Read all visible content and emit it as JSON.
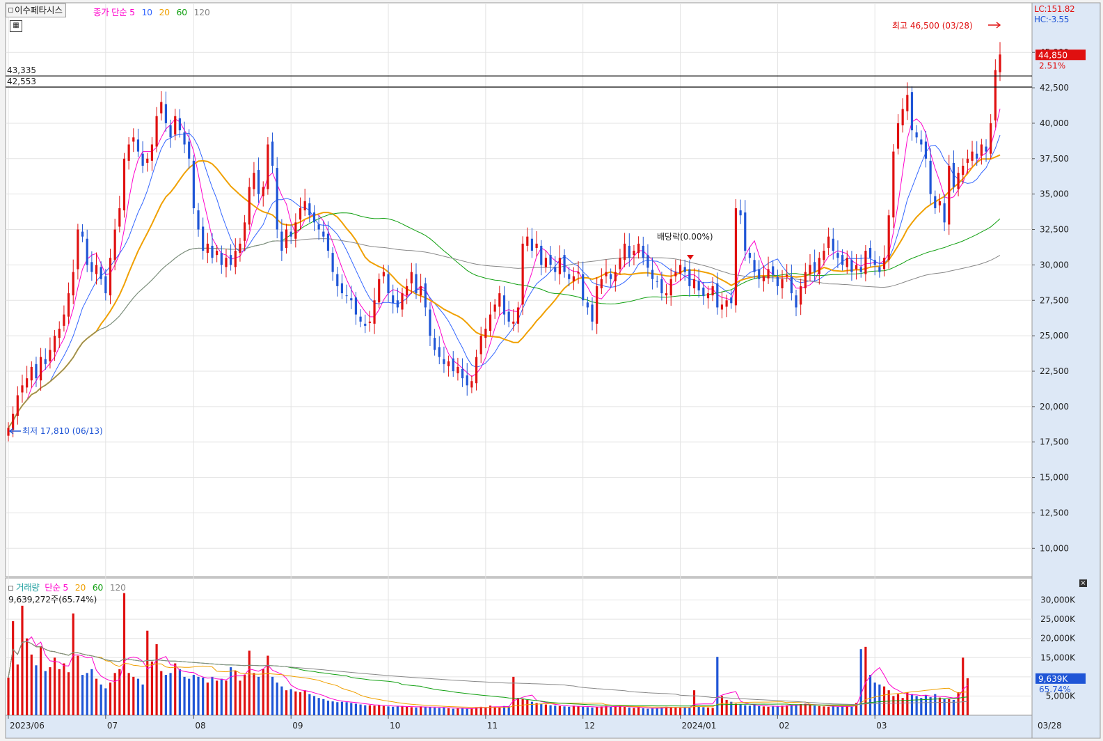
{
  "header": {
    "stock_name": "이수페타시스",
    "price_ma_title": "종가 단순",
    "price_ma_periods": [
      "5",
      "10",
      "20",
      "60",
      "120"
    ],
    "price_ma_colors": [
      "#ff00cc",
      "#3366ff",
      "#f0a000",
      "#11a011",
      "#888888"
    ],
    "volume_title": "거래량",
    "volume_ma_title": "단순",
    "volume_ma_periods": [
      "5",
      "20",
      "60",
      "120"
    ],
    "volume_ma_colors": [
      "#ff00cc",
      "#f0a000",
      "#11a011",
      "#888888"
    ],
    "volume_readout": "9,639,272주(65.74%)",
    "lc_label": "LC:151.82",
    "hc_label": "HC:-3.55"
  },
  "icons": {
    "grid": "grid-icon",
    "pane_close": "close-icon"
  },
  "colors": {
    "up": "#e01010",
    "down": "#1f55d6",
    "current_price_box": "#e01010",
    "current_volume_box": "#1f55d6"
  },
  "annotations": {
    "high_label": "최고 46,500 (03/28)",
    "low_label": "최저 17,810 (06/13)",
    "dividend_label": "배당락(0.00%)",
    "hline_upper_label": "43,335",
    "hline_lower_label": "42,553",
    "current_price": "44,850",
    "current_change": "2.51%",
    "current_volume": "9,639K",
    "current_volume_pct": "65.74%"
  },
  "chart_data": [
    {
      "type": "candlestick",
      "title": "이수페타시스",
      "y_ticks": [
        "10,000",
        "12,500",
        "15,000",
        "17,500",
        "20,000",
        "22,500",
        "25,000",
        "27,500",
        "30,000",
        "32,500",
        "35,000",
        "37,500",
        "40,000",
        "42,500",
        "45,000"
      ],
      "ylim": [
        8000,
        48500
      ],
      "hlines": [
        43335,
        42553
      ],
      "x_labels": [
        "2023/06",
        "07",
        "08",
        "09",
        "10",
        "11",
        "12",
        "2024/01",
        "02",
        "03",
        "03/28"
      ],
      "high": 46500,
      "low": 17810,
      "last_close": 44850,
      "last_change_pct": 2.51,
      "moving_averages": [
        "5",
        "10",
        "20",
        "60",
        "120"
      ],
      "close_series": [
        18500,
        19500,
        20800,
        21500,
        22000,
        22800,
        22000,
        23500,
        23000,
        24000,
        25000,
        25500,
        26500,
        28000,
        29500,
        32500,
        32000,
        30000,
        29500,
        30000,
        29000,
        28000,
        30500,
        32500,
        34000,
        37500,
        38500,
        39000,
        38000,
        37000,
        37500,
        38500,
        40500,
        41500,
        40000,
        39000,
        40500,
        39500,
        38500,
        37500,
        34000,
        32500,
        31000,
        31500,
        30500,
        31000,
        30000,
        30500,
        30000,
        31000,
        31500,
        33000,
        35500,
        36500,
        35000,
        35500,
        38500,
        37000,
        32500,
        31000,
        32500,
        32000,
        33000,
        34000,
        34500,
        33500,
        33000,
        32500,
        32000,
        31000,
        29500,
        28500,
        28000,
        27800,
        27500,
        26500,
        26000,
        25700,
        26000,
        27500,
        29000,
        29500,
        28000,
        27300,
        27000,
        28000,
        28500,
        29500,
        28000,
        28500,
        27000,
        25000,
        24000,
        23500,
        23000,
        23200,
        22500,
        22800,
        22000,
        21500,
        21800,
        23500,
        25000,
        25500,
        26500,
        27200,
        28000,
        26500,
        26000,
        26000,
        27000,
        31500,
        32000,
        31000,
        31500,
        30000,
        30500,
        30000,
        29500,
        30500,
        29500,
        29000,
        29200,
        29500,
        27500,
        27000,
        26000,
        28500,
        29000,
        29500,
        29000,
        29500,
        30500,
        31500,
        30500,
        31000,
        31500,
        30500,
        29800,
        29000,
        28800,
        28000,
        28000,
        29000,
        29500,
        30000,
        29500,
        28500,
        29000,
        28200,
        27800,
        28000,
        28500,
        27000,
        27200,
        27500,
        27300,
        34000,
        33500,
        31000,
        30500,
        29500,
        29000,
        29200,
        29700,
        29300,
        28500,
        29000,
        29300,
        28000,
        27000,
        28500,
        29500,
        30000,
        29500,
        30500,
        31000,
        32000,
        31000,
        30500,
        30000,
        30500,
        29500,
        30000,
        29500,
        31000,
        30500,
        30000,
        29500,
        30500,
        33500,
        38000,
        40000,
        41000,
        42000,
        39500,
        39000,
        38500,
        37500,
        35000,
        34000,
        34500,
        33000,
        37000,
        35500,
        36500,
        37000,
        37500,
        38000,
        37500,
        38500,
        38000,
        40000,
        43750,
        44850
      ]
    },
    {
      "type": "bar",
      "title": "거래량",
      "y_ticks": [
        "5,000K",
        "10,000K",
        "15,000K",
        "20,000K",
        "25,000K",
        "30,000K"
      ],
      "ylim": [
        0,
        33000
      ],
      "unit": "K",
      "last_volume": 9639272,
      "last_volume_pct": 65.74,
      "moving_averages": [
        "5",
        "20",
        "60",
        "120"
      ],
      "volume_series_k": [
        9800,
        24500,
        13200,
        28500,
        20000,
        15800,
        13000,
        18000,
        11500,
        12500,
        15000,
        12000,
        13500,
        11200,
        26500,
        15500,
        10500,
        11000,
        12000,
        9500,
        8000,
        7000,
        8500,
        11000,
        12000,
        31800,
        11000,
        10000,
        9500,
        8000,
        22000,
        14000,
        18500,
        11500,
        10500,
        11000,
        13500,
        12000,
        10000,
        9500,
        10500,
        10000,
        9800,
        8500,
        10000,
        9000,
        9500,
        9000,
        12500,
        11500,
        9000,
        10500,
        16800,
        11000,
        10000,
        12000,
        15500,
        10000,
        8500,
        7500,
        6500,
        6800,
        6200,
        6000,
        6500,
        5500,
        5000,
        4500,
        4200,
        3800,
        3600,
        3400,
        3500,
        3400,
        3200,
        3000,
        2800,
        2600,
        2600,
        2500,
        2700,
        2400,
        2300,
        2200,
        2300,
        2400,
        2200,
        2100,
        2000,
        2300,
        2200,
        2100,
        2000,
        1900,
        2000,
        1800,
        1700,
        1800,
        1900,
        1700,
        1800,
        2000,
        2200,
        2100,
        2500,
        2200,
        2000,
        2400,
        2300,
        10000,
        4500,
        4200,
        4000,
        3500,
        3200,
        3000,
        2800,
        2600,
        2500,
        2400,
        2300,
        2200,
        2500,
        2300,
        2200,
        2100,
        2000,
        2200,
        2300,
        2400,
        2200,
        2300,
        2400,
        2200,
        2000,
        1900,
        2000,
        1800,
        1700,
        1800,
        1900,
        2000,
        2200,
        2100,
        2000,
        1900,
        2000,
        1900,
        6500,
        2200,
        2100,
        2000,
        1900,
        15200,
        5000,
        4000,
        3500,
        3000,
        2800,
        2600,
        2500,
        2700,
        2400,
        2300,
        2200,
        2300,
        2400,
        2500,
        2600,
        2700,
        2800,
        2900,
        3000,
        2700,
        2500,
        2400,
        2300,
        2200,
        2400,
        2200,
        2300,
        2400,
        2200,
        3200,
        17200,
        17800,
        10500,
        8500,
        8000,
        7500,
        6500,
        5000,
        5500,
        4500,
        6000,
        5500,
        5000,
        4500,
        5200,
        4700,
        5500,
        4600,
        4300,
        4200,
        4000,
        6000,
        15000,
        9639
      ]
    }
  ]
}
